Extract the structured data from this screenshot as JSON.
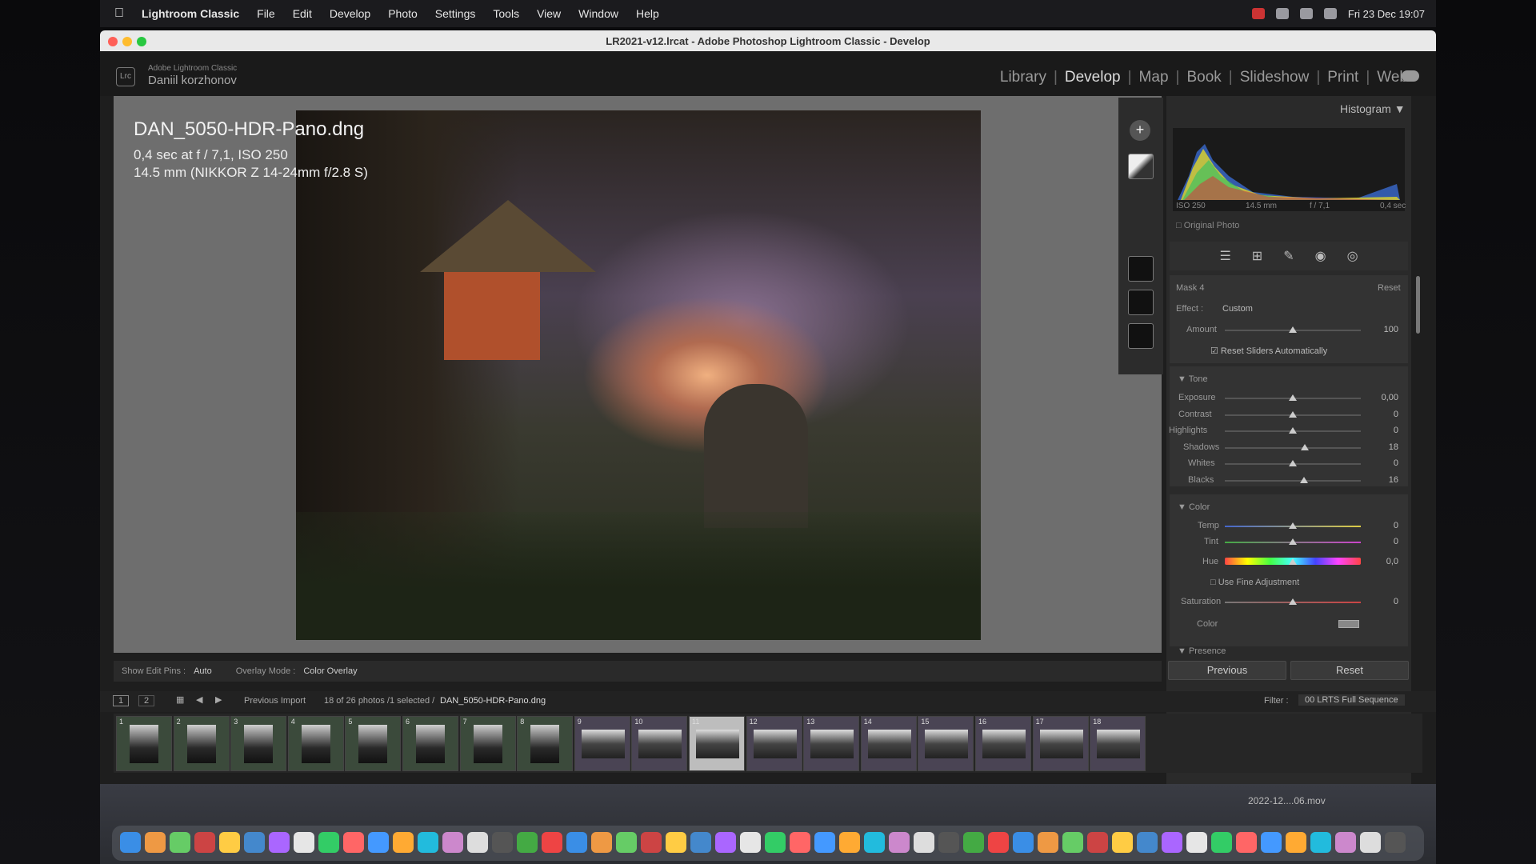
{
  "menubar": {
    "app": "Lightroom Classic",
    "items": [
      "File",
      "Edit",
      "Develop",
      "Photo",
      "Settings",
      "Tools",
      "View",
      "Window",
      "Help"
    ],
    "clock": "Fri 23 Dec  19:07"
  },
  "window": {
    "title": "LR2021-v12.lrcat - Adobe Photoshop Lightroom Classic - Develop"
  },
  "brand": {
    "logo": "Lrc",
    "line1": "Adobe Lightroom Classic",
    "line2": "Daniil korzhonov"
  },
  "modules": [
    "Library",
    "Develop",
    "Map",
    "Book",
    "Slideshow",
    "Print",
    "Web"
  ],
  "active_module": "Develop",
  "photo_info": {
    "filename": "DAN_5050-HDR-Pano.dng",
    "exposure": "0,4 sec at f / 7,1, ISO 250",
    "lens": "14.5 mm (NIKKOR Z 14-24mm f/2.8 S)"
  },
  "view_toolbar": {
    "pins_label": "Show Edit Pins :",
    "pins_value": "Auto",
    "overlay_label": "Overlay Mode :",
    "overlay_value": "Color Overlay"
  },
  "histogram": {
    "title": "Histogram",
    "iso": "ISO 250",
    "focal": "14.5 mm",
    "aperture": "f / 7,1",
    "shutter": "0,4 sec",
    "original_photo": "Original Photo"
  },
  "mask": {
    "name": "Mask 4",
    "reset": "Reset",
    "effect_label": "Effect :",
    "effect_value": "Custom",
    "amount_label": "Amount",
    "amount_value": 100,
    "reset_sliders": "Reset Sliders Automatically"
  },
  "tone": {
    "title": "Tone",
    "sliders": [
      {
        "label": "Exposure",
        "value": "0,00",
        "pos": 0.5
      },
      {
        "label": "Contrast",
        "value": "0",
        "pos": 0.5
      },
      {
        "label": "Highlights",
        "value": "0",
        "pos": 0.5
      },
      {
        "label": "Shadows",
        "value": "18",
        "pos": 0.59
      },
      {
        "label": "Whites",
        "value": "0",
        "pos": 0.5
      },
      {
        "label": "Blacks",
        "value": "16",
        "pos": 0.58
      }
    ]
  },
  "color": {
    "title": "Color",
    "temp_label": "Temp",
    "temp_value": "0",
    "tint_label": "Tint",
    "tint_value": "0",
    "hue_label": "Hue",
    "hue_value": "0,0",
    "fine_adjust": "Use Fine Adjustment",
    "saturation_label": "Saturation",
    "saturation_value": "0",
    "color_label": "Color"
  },
  "presence_title": "Presence",
  "buttons": {
    "previous": "Previous",
    "reset": "Reset"
  },
  "filmstrip_bar": {
    "page1": "1",
    "page2": "2",
    "source": "Previous Import",
    "count": "18 of 26 photos /1 selected /",
    "selected_file": "DAN_5050-HDR-Pano.dng",
    "filter_label": "Filter :",
    "filter_value": "00 LRTS Full Sequence"
  },
  "thumbs": [
    "1",
    "2",
    "3",
    "4",
    "5",
    "6",
    "7",
    "8",
    "9",
    "10",
    "11",
    "12",
    "13",
    "14",
    "15",
    "16",
    "17",
    "18"
  ],
  "selected_thumb": "11",
  "desktop": {
    "video_label": "2022-12....06.mov"
  },
  "colors": {
    "accent": "#dddddd",
    "panel": "#2a2a2a",
    "view_bg": "#6e6e6e"
  }
}
